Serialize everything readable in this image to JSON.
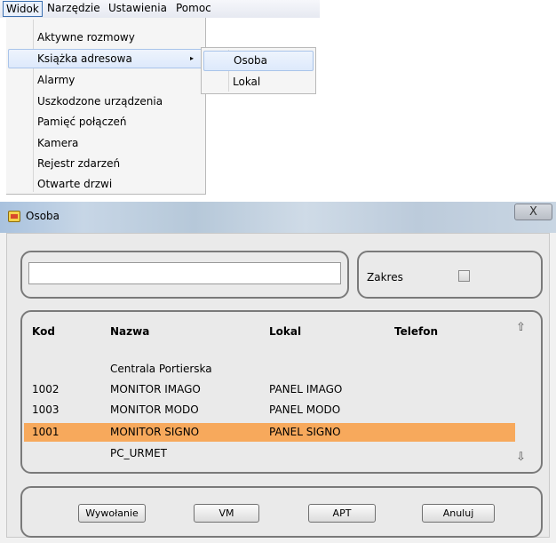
{
  "menubar": {
    "items": [
      "Widok",
      "Narzędzie",
      "Ustawienia",
      "Pomoc"
    ]
  },
  "dropdown": {
    "items": [
      "Aktywne rozmowy",
      "Książka adresowa",
      "Alarmy",
      "Uszkodzone urządzenia",
      "Pamięć połączeń",
      "Kamera",
      "Rejestr zdarzeń",
      "Otwarte drzwi"
    ],
    "submenu_arrow": "▸"
  },
  "submenu": {
    "items": [
      "Osoba",
      "Lokal"
    ]
  },
  "dialog": {
    "title": "Osoba",
    "close_label": "X",
    "search": {
      "value": "",
      "placeholder": ""
    },
    "zakres_label": "Zakres",
    "zakres_checked": false,
    "table": {
      "headers": {
        "kod": "Kod",
        "nazwa": "Nazwa",
        "lokal": "Lokal",
        "telefon": "Telefon"
      },
      "rows": [
        {
          "kod": "",
          "nazwa": "Centrala Portierska",
          "lokal": "",
          "telefon": ""
        },
        {
          "kod": "1002",
          "nazwa": "MONITOR IMAGO",
          "lokal": "PANEL IMAGO",
          "telefon": ""
        },
        {
          "kod": "1003",
          "nazwa": "MONITOR MODO",
          "lokal": "PANEL MODO",
          "telefon": ""
        },
        {
          "kod": "1001",
          "nazwa": "MONITOR SIGNO",
          "lokal": "PANEL SIGNO",
          "telefon": ""
        },
        {
          "kod": "",
          "nazwa": "PC_URMET",
          "lokal": "",
          "telefon": ""
        }
      ],
      "selected_row": 3,
      "selection_color": "#f7a95c"
    },
    "buttons": {
      "call": "Wywołanie",
      "vm": "VM",
      "apt": "APT",
      "cancel": "Anuluj"
    }
  }
}
